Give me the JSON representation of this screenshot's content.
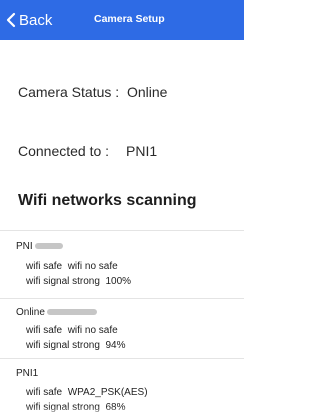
{
  "header": {
    "back_label": "Back",
    "title": "Camera Setup",
    "bar_color": "#2e6be5"
  },
  "status": {
    "label": "Camera Status :",
    "value": "Online"
  },
  "connection": {
    "label": "Connected to :",
    "value": "PNI1"
  },
  "scan": {
    "title": "Wifi networks scanning",
    "networks": [
      {
        "ssid": "PNI",
        "safe": "wifi safe",
        "security": "wifi no safe",
        "signal_label": "wifi signal strong",
        "signal": "100%"
      },
      {
        "ssid": "Online",
        "safe": "wifi safe",
        "security": "wifi no safe",
        "signal_label": "wifi signal strong",
        "signal": "94%"
      },
      {
        "ssid": "PNI1",
        "safe": "wifi safe",
        "security": "WPA2_PSK(AES)",
        "signal_label": "wifi signal strong",
        "signal": "68%"
      }
    ]
  }
}
